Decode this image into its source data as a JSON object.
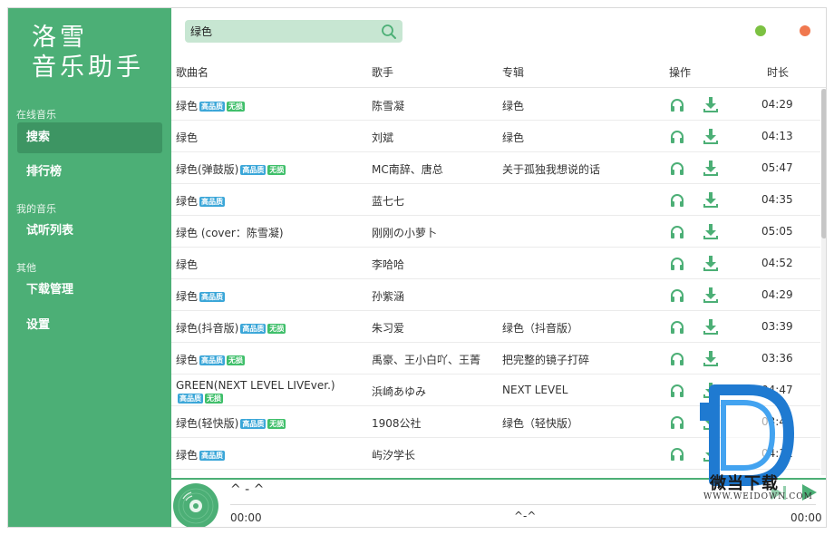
{
  "app": {
    "logo_line1": "洛雪",
    "logo_line2": "音乐助手"
  },
  "sidebar": {
    "sections": [
      {
        "label": "在线音乐",
        "items": [
          {
            "label": "搜索",
            "active": true
          },
          {
            "label": "排行榜",
            "active": false
          }
        ]
      },
      {
        "label": "我的音乐",
        "items": [
          {
            "label": "试听列表",
            "active": false
          }
        ]
      },
      {
        "label": "其他",
        "items": [
          {
            "label": "下载管理",
            "active": false
          },
          {
            "label": "设置",
            "active": false
          }
        ]
      }
    ]
  },
  "search": {
    "value": "绿色",
    "icon": "search-icon"
  },
  "window_controls": {
    "minimize_color": "#7cc142",
    "close_color": "#f0784f"
  },
  "table": {
    "headers": {
      "name": "歌曲名",
      "singer": "歌手",
      "album": "专辑",
      "action": "操作",
      "duration": "时长"
    },
    "badge_hq": "高品质",
    "badge_lossless": "无损",
    "rows": [
      {
        "name": "绿色",
        "hq": true,
        "lossless": true,
        "singer": "陈雪凝",
        "album": "绿色",
        "duration": "04:29"
      },
      {
        "name": "绿色",
        "hq": false,
        "lossless": false,
        "singer": "刘斌",
        "album": "绿色",
        "duration": "04:13"
      },
      {
        "name": "绿色(弹鼓版)",
        "hq": true,
        "lossless": true,
        "singer": "MC南辞、唐总",
        "album": "关于孤独我想说的话",
        "duration": "05:47"
      },
      {
        "name": "绿色",
        "hq": true,
        "lossless": false,
        "singer": "蓝七七",
        "album": "",
        "duration": "04:35"
      },
      {
        "name": "绿色 (cover：陈雪凝)",
        "hq": false,
        "lossless": false,
        "singer": "刚刚の小萝卜",
        "album": "",
        "duration": "05:05"
      },
      {
        "name": "绿色",
        "hq": false,
        "lossless": false,
        "singer": "李哈哈",
        "album": "",
        "duration": "04:52"
      },
      {
        "name": "绿色",
        "hq": true,
        "lossless": false,
        "singer": "孙紫涵",
        "album": "",
        "duration": "04:29"
      },
      {
        "name": "绿色(抖音版)",
        "hq": true,
        "lossless": true,
        "singer": "朱习爱",
        "album": "绿色（抖音版）",
        "duration": "03:39"
      },
      {
        "name": "绿色",
        "hq": true,
        "lossless": true,
        "singer": "禹豪、王小白吖、王菁",
        "album": "把完整的镜子打碎",
        "duration": "03:36"
      },
      {
        "name": "GREEN(NEXT LEVEL LIVEver.)",
        "hq": true,
        "lossless": true,
        "singer": "浜崎あゆみ",
        "album": "NEXT LEVEL",
        "duration": "04:47",
        "wrap": true
      },
      {
        "name": "绿色(轻快版)",
        "hq": true,
        "lossless": true,
        "singer": "1908公社",
        "album": "绿色（轻快版）",
        "duration": "03:41"
      },
      {
        "name": "绿色",
        "hq": true,
        "lossless": false,
        "singer": "屿汐学长",
        "album": "",
        "duration": "04:31"
      }
    ]
  },
  "player": {
    "title": "^ - ^",
    "time_start": "00:00",
    "center_text": "^-^",
    "time_end": "00:00"
  },
  "watermark": {
    "text": "微当下载",
    "url": "WWW.WEIDOWN.COM"
  },
  "colors": {
    "sidebar": "#4caf76",
    "accent": "#3d9563",
    "icon_green": "#4caf76"
  }
}
